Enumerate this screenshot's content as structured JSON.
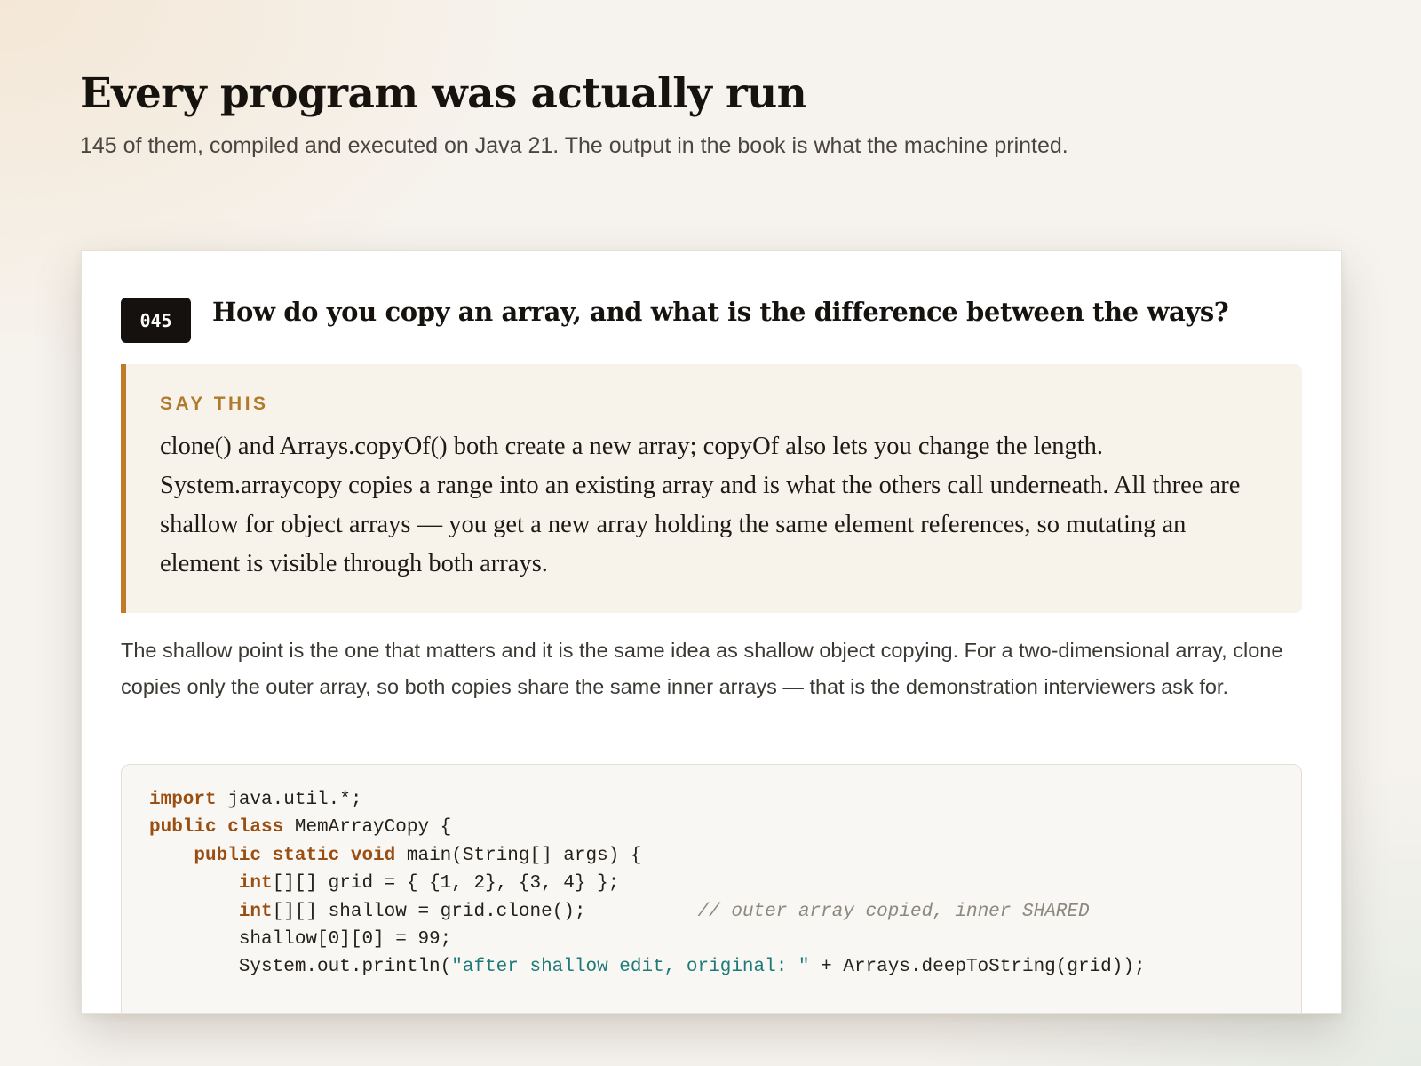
{
  "page": {
    "title": "Every program was actually run",
    "subtitle": "145 of them, compiled and executed on Java 21. The output in the book is what the machine printed."
  },
  "card": {
    "number": "045",
    "question": "How do you copy an array, and what is the difference between the ways?",
    "say_this": {
      "label": "SAY THIS",
      "text": "clone() and Arrays.copyOf() both create a new array; copyOf also lets you change the length. System.arraycopy copies a range into an existing array and is what the others call underneath. All three are shallow for object arrays — you get a new array holding the same element references, so mutating an element is visible through both arrays."
    },
    "explanation": "The shallow point is the one that matters and it is the same idea as shallow object copying. For a two-dimensional array, clone copies only the outer array, so both copies share the same inner arrays — that is the demonstration interviewers ask for.",
    "code": {
      "language": "java",
      "lines": [
        [
          {
            "t": "kw",
            "s": "import"
          },
          {
            "t": "plain",
            "s": " java.util.*;"
          }
        ],
        [
          {
            "t": "kw",
            "s": "public class"
          },
          {
            "t": "plain",
            "s": " MemArrayCopy {"
          }
        ],
        [
          {
            "t": "plain",
            "s": "    "
          },
          {
            "t": "kw",
            "s": "public static void"
          },
          {
            "t": "plain",
            "s": " main(String[] args) {"
          }
        ],
        [
          {
            "t": "plain",
            "s": "        "
          },
          {
            "t": "kw",
            "s": "int"
          },
          {
            "t": "plain",
            "s": "[][] grid = { {1, 2}, {3, 4} };"
          }
        ],
        [
          {
            "t": "plain",
            "s": "        "
          },
          {
            "t": "kw",
            "s": "int"
          },
          {
            "t": "plain",
            "s": "[][] shallow = grid.clone();          "
          },
          {
            "t": "cmt",
            "s": "// outer array copied, inner SHARED"
          }
        ],
        [
          {
            "t": "plain",
            "s": "        shallow[0][0] = 99;"
          }
        ],
        [
          {
            "t": "plain",
            "s": "        System.out.println("
          },
          {
            "t": "str",
            "s": "\"after shallow edit, original: \""
          },
          {
            "t": "plain",
            "s": " + Arrays.deepToString(grid));"
          }
        ]
      ]
    },
    "colors": {
      "accent": "#c07a2a",
      "keyword": "#9a4e12",
      "string": "#1e7a78",
      "comment": "#8c877f"
    }
  }
}
